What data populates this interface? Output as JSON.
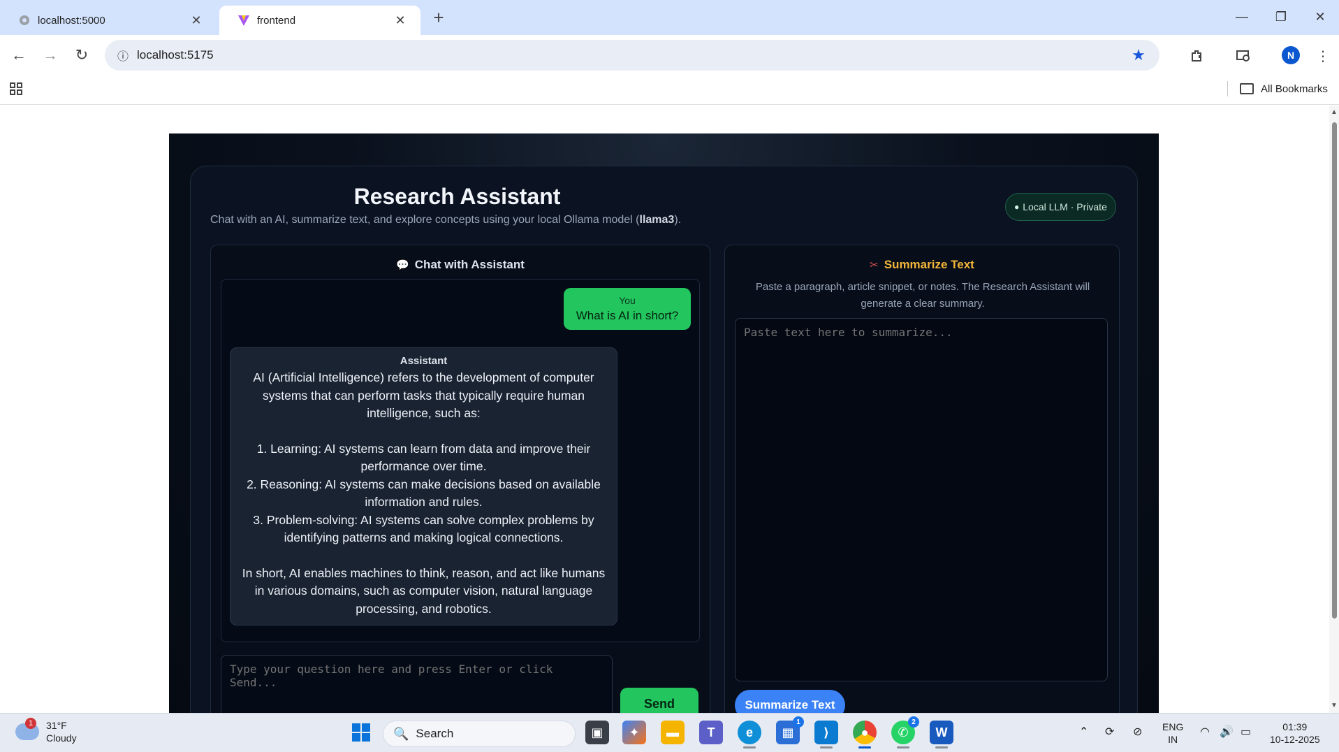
{
  "browser": {
    "tabs": [
      {
        "title": "localhost:5000",
        "active": false
      },
      {
        "title": "frontend",
        "active": true
      }
    ],
    "url": "localhost:5175",
    "bookmarks_label": "All Bookmarks",
    "profile_initial": "N",
    "icons": [
      "back-icon",
      "forward-icon",
      "reload-icon",
      "site-info-icon",
      "bookmark-star-icon",
      "extensions-icon",
      "media-icon",
      "menu-icon",
      "apps-grid-icon",
      "folder-icon"
    ]
  },
  "app": {
    "title": "Research Assistant",
    "subtitle_prefix": "Chat with an AI, summarize text, and explore concepts using your local Ollama model (",
    "model": "llama3",
    "subtitle_suffix": ").",
    "badge": "Local LLM · Private",
    "chat": {
      "heading": "Chat with Assistant",
      "messages": [
        {
          "role": "You",
          "text": "What is AI in short?"
        },
        {
          "role": "Assistant",
          "intro": "AI (Artificial Intelligence) refers to the development of computer systems that can perform tasks that typically require human intelligence, such as:",
          "items": [
            "1. Learning: AI systems can learn from data and improve their performance over time.",
            "2. Reasoning: AI systems can make decisions based on available information and rules.",
            "3. Problem-solving: AI systems can solve complex problems by identifying patterns and making logical connections."
          ],
          "outro": "In short, AI enables machines to think, reason, and act like humans in various domains, such as computer vision, natural language processing, and robotics."
        }
      ],
      "input_placeholder": "Type your question here and press Enter or click Send...",
      "send_label": "Send"
    },
    "summarize": {
      "heading": "Summarize Text",
      "description": "Paste a paragraph, article snippet, or notes. The Research Assistant will generate a clear summary.",
      "input_placeholder": "Paste text here to summarize...",
      "button_label": "Summarize Text"
    },
    "colors": {
      "accent_green": "#22c55e",
      "accent_blue": "#3b82f6",
      "accent_amber": "#f3b63a",
      "background": "#0b1322"
    }
  },
  "taskbar": {
    "weather_temp": "31°F",
    "weather_desc": "Cloudy",
    "weather_alert_count": "1",
    "search_label": "Search",
    "teams_badge": "1",
    "whatsapp_badge": "2",
    "language_line1": "ENG",
    "language_line2": "IN",
    "time": "01:39",
    "date": "10-12-2025"
  }
}
